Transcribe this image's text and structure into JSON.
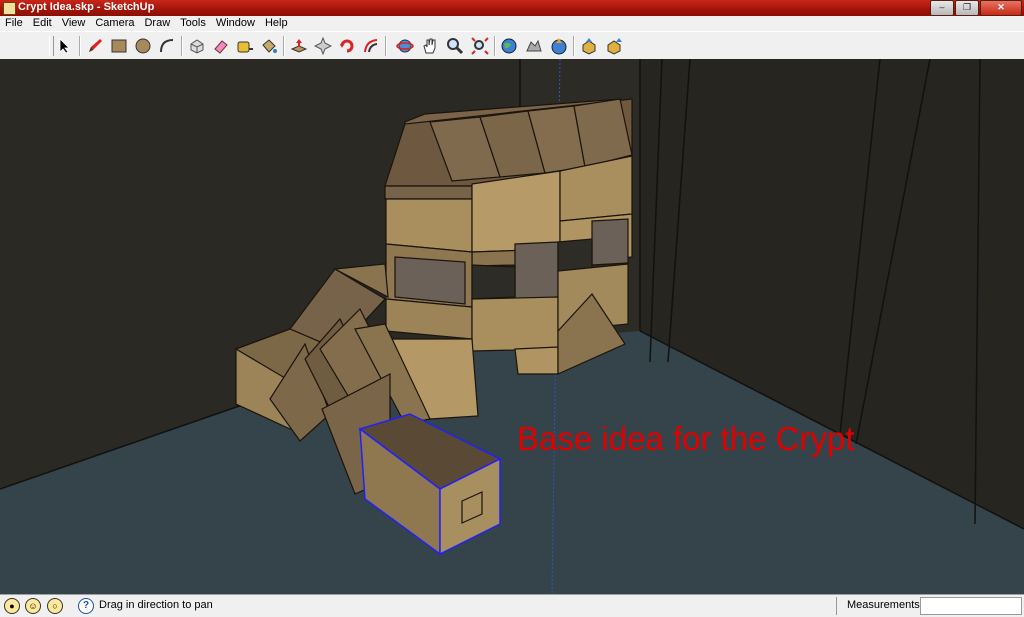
{
  "window": {
    "title": "Crypt Idea.skp - SketchUp"
  },
  "menu": [
    "File",
    "Edit",
    "View",
    "Camera",
    "Draw",
    "Tools",
    "Window",
    "Help"
  ],
  "toolbar": [
    {
      "name": "select-tool",
      "icon": "arrow-icon"
    },
    {
      "name": "pencil-tool",
      "icon": "pencil-icon"
    },
    {
      "name": "rectangle-tool",
      "icon": "rectangle-icon"
    },
    {
      "name": "circle-tool",
      "icon": "circle-icon"
    },
    {
      "name": "arc-tool",
      "icon": "arc-icon"
    },
    {
      "name": "make-component-tool",
      "icon": "component-icon"
    },
    {
      "name": "eraser-tool",
      "icon": "eraser-icon"
    },
    {
      "name": "tape-measure-tool",
      "icon": "tape-measure-icon"
    },
    {
      "name": "paint-bucket-tool",
      "icon": "paint-bucket-icon"
    },
    {
      "name": "push-pull-tool",
      "icon": "push-pull-icon"
    },
    {
      "name": "move-tool",
      "icon": "move-icon"
    },
    {
      "name": "rotate-tool",
      "icon": "rotate-icon"
    },
    {
      "name": "offset-tool",
      "icon": "offset-icon"
    },
    {
      "name": "orbit-tool",
      "icon": "orbit-icon"
    },
    {
      "name": "pan-tool",
      "icon": "hand-icon"
    },
    {
      "name": "zoom-tool",
      "icon": "zoom-icon"
    },
    {
      "name": "zoom-extents-tool",
      "icon": "zoom-extents-icon"
    },
    {
      "name": "get-current-view-tool",
      "icon": "earth-icon"
    },
    {
      "name": "toggle-terrain-tool",
      "icon": "terrain-icon"
    },
    {
      "name": "place-model-tool",
      "icon": "place-model-icon"
    },
    {
      "name": "get-models-tool",
      "icon": "get-models-icon"
    },
    {
      "name": "share-model-tool",
      "icon": "share-model-icon"
    }
  ],
  "viewport": {
    "annotation": "Base idea for the Crypt"
  },
  "statusbar": {
    "hint": "Drag in direction to pan",
    "measurements_label": "Measurements",
    "measurements_value": ""
  },
  "colors": {
    "title_bar": "#a11408",
    "wall": "#2d2b26",
    "floor": "#35444a",
    "stone": "#8a7450",
    "annotation": "#e00000",
    "selection": "#2020ff"
  }
}
